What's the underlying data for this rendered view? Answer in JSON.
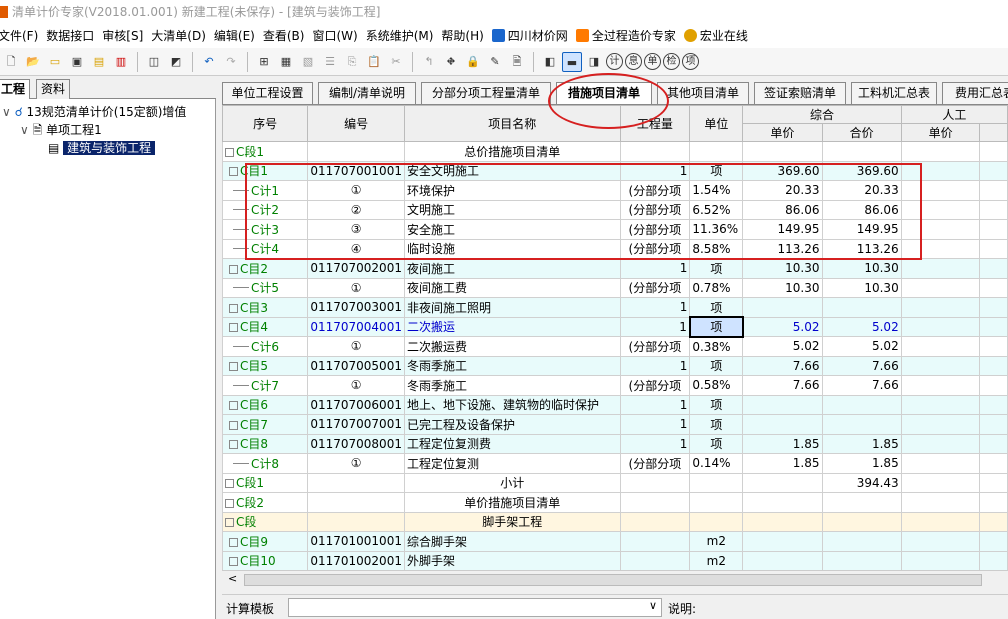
{
  "window": {
    "title": "清单计价专家(V2018.01.001) 新建工程(未保存) - [建筑与装饰工程]"
  },
  "menu": {
    "items": [
      "文件(F)",
      "数据接口",
      "审核[S]",
      "大清单(D)",
      "编辑(E)",
      "查看(B)",
      "窗口(W)",
      "系统维护(M)",
      "帮助(H)"
    ],
    "links": [
      {
        "label": "四川材价网",
        "color": "#1a66cc"
      },
      {
        "label": "全过程造价专家",
        "color": "#ff7a00"
      },
      {
        "label": "宏业在线",
        "color": "#e0a000"
      }
    ]
  },
  "toolbar": {
    "zoom_icons": [
      "计",
      "息",
      "单",
      "检",
      "项"
    ]
  },
  "left": {
    "tabs": [
      "工程",
      "资料"
    ],
    "tree": [
      {
        "label": "13规范清单计价(15定额)增值"
      },
      {
        "label": "单项工程1"
      },
      {
        "label": "建筑与装饰工程"
      }
    ]
  },
  "tabs": [
    "单位工程设置",
    "编制/清单说明",
    "分部分项工程量清单",
    "措施项目清单",
    "其他项目清单",
    "签证索赔清单",
    "工料机汇总表",
    "费用汇总表"
  ],
  "active_tab": "措施项目清单",
  "headers": {
    "seq": "序号",
    "code": "编号",
    "name": "项目名称",
    "qty": "工程量",
    "unit": "单位",
    "group1": "综合",
    "price": "单价",
    "total": "合价",
    "group2": "人工",
    "price2": "单价"
  },
  "rows": [
    {
      "seq": "C段1",
      "code": "",
      "name": "总价措施项目清单",
      "qty": "",
      "unit": "",
      "price": "",
      "total": "",
      "type": "section"
    },
    {
      "seq": "C目1",
      "code": "011707001001",
      "name": "安全文明施工",
      "qty": "1",
      "unit": "项",
      "price": "369.60",
      "total": "369.60",
      "type": "item"
    },
    {
      "seq": "C计1",
      "code": "①",
      "name": "环境保护",
      "qty": "(分部分项",
      "unit": "1.54%",
      "price": "20.33",
      "total": "20.33",
      "type": "calc"
    },
    {
      "seq": "C计2",
      "code": "②",
      "name": "文明施工",
      "qty": "(分部分项",
      "unit": "6.52%",
      "price": "86.06",
      "total": "86.06",
      "type": "calc"
    },
    {
      "seq": "C计3",
      "code": "③",
      "name": "安全施工",
      "qty": "(分部分项",
      "unit": "11.36%",
      "price": "149.95",
      "total": "149.95",
      "type": "calc"
    },
    {
      "seq": "C计4",
      "code": "④",
      "name": "临时设施",
      "qty": "(分部分项",
      "unit": "8.58%",
      "price": "113.26",
      "total": "113.26",
      "type": "calc"
    },
    {
      "seq": "C目2",
      "code": "011707002001",
      "name": "夜间施工",
      "qty": "1",
      "unit": "项",
      "price": "10.30",
      "total": "10.30",
      "type": "item"
    },
    {
      "seq": "C计5",
      "code": "①",
      "name": "夜间施工费",
      "qty": "(分部分项",
      "unit": "0.78%",
      "price": "10.30",
      "total": "10.30",
      "type": "calc"
    },
    {
      "seq": "C目3",
      "code": "011707003001",
      "name": "非夜间施工照明",
      "qty": "1",
      "unit": "项",
      "price": "",
      "total": "",
      "type": "item"
    },
    {
      "seq": "C目4",
      "code": "011707004001",
      "name": "二次搬运",
      "qty": "1",
      "unit": "项",
      "price": "5.02",
      "total": "5.02",
      "type": "item-sel"
    },
    {
      "seq": "C计6",
      "code": "①",
      "name": "二次搬运费",
      "qty": "(分部分项",
      "unit": "0.38%",
      "price": "5.02",
      "total": "5.02",
      "type": "calc"
    },
    {
      "seq": "C目5",
      "code": "011707005001",
      "name": "冬雨季施工",
      "qty": "1",
      "unit": "项",
      "price": "7.66",
      "total": "7.66",
      "type": "item"
    },
    {
      "seq": "C计7",
      "code": "①",
      "name": "冬雨季施工",
      "qty": "(分部分项",
      "unit": "0.58%",
      "price": "7.66",
      "total": "7.66",
      "type": "calc"
    },
    {
      "seq": "C目6",
      "code": "011707006001",
      "name": "地上、地下设施、建筑物的临时保护",
      "qty": "1",
      "unit": "项",
      "price": "",
      "total": "",
      "type": "item"
    },
    {
      "seq": "C目7",
      "code": "011707007001",
      "name": "已完工程及设备保护",
      "qty": "1",
      "unit": "项",
      "price": "",
      "total": "",
      "type": "item"
    },
    {
      "seq": "C目8",
      "code": "011707008001",
      "name": "工程定位复测费",
      "qty": "1",
      "unit": "项",
      "price": "1.85",
      "total": "1.85",
      "type": "item"
    },
    {
      "seq": "C计8",
      "code": "①",
      "name": "工程定位复测",
      "qty": "(分部分项",
      "unit": "0.14%",
      "price": "1.85",
      "total": "1.85",
      "type": "calc"
    },
    {
      "seq": "C段1",
      "code": "",
      "name": "小计",
      "qty": "",
      "unit": "",
      "price": "",
      "total": "394.43",
      "type": "subtotal"
    },
    {
      "seq": "C段2",
      "code": "",
      "name": "单价措施项目清单",
      "qty": "",
      "unit": "",
      "price": "",
      "total": "",
      "type": "section"
    },
    {
      "seq": "C段",
      "code": "",
      "name": "脚手架工程",
      "qty": "",
      "unit": "",
      "price": "",
      "total": "",
      "type": "subsection"
    },
    {
      "seq": "C目9",
      "code": "011701001001",
      "name": "综合脚手架",
      "qty": "",
      "unit": "m2",
      "price": "",
      "total": "",
      "type": "item"
    },
    {
      "seq": "C目10",
      "code": "011701002001",
      "name": "外脚手架",
      "qty": "",
      "unit": "m2",
      "price": "",
      "total": "",
      "type": "item"
    }
  ],
  "status": {
    "template_label": "计算模板",
    "note_label": "说明:"
  },
  "colors": {
    "accent_red": "#d62020",
    "seq_green": "#008000",
    "item_bg": "#e8fbfb",
    "calc_bg": "#ffffff",
    "subsection_bg": "#fff6e0",
    "selected_code": "#0000cc"
  }
}
